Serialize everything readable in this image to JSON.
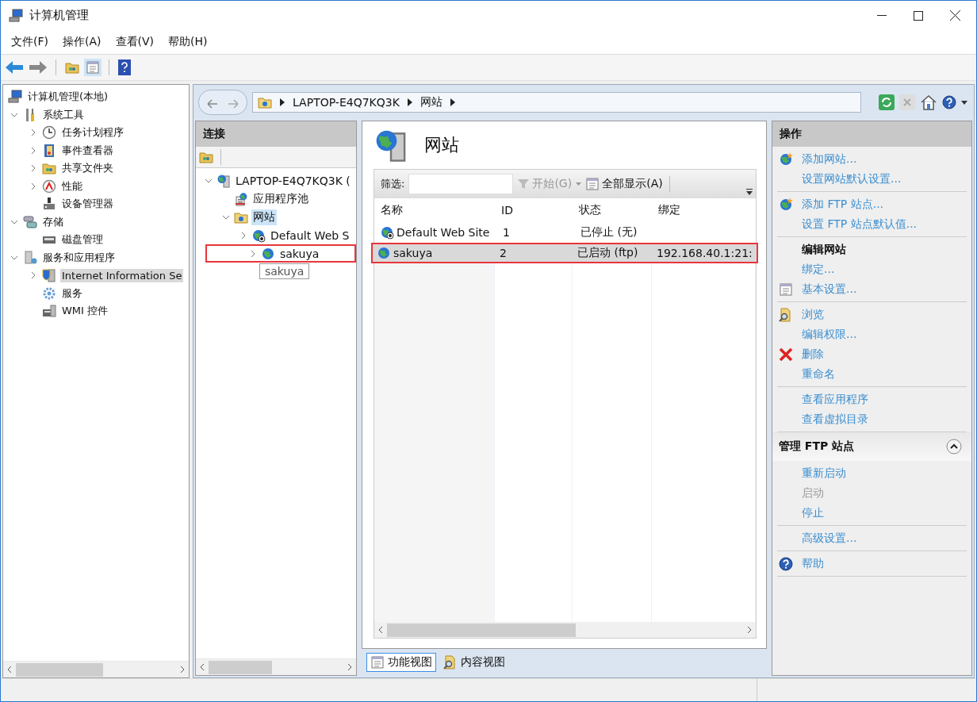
{
  "window": {
    "title": "计算机管理"
  },
  "menu": [
    "文件(F)",
    "操作(A)",
    "查看(V)",
    "帮助(H)"
  ],
  "console_tree": {
    "items": [
      {
        "label": "计算机管理(本地)",
        "selected": false,
        "children": [
          {
            "label": "系统工具",
            "expanded": true,
            "selected": false,
            "children": [
              {
                "label": "任务计划程序",
                "expanded": false,
                "selected": false
              },
              {
                "label": "事件查看器",
                "expanded": false,
                "selected": false
              },
              {
                "label": "共享文件夹",
                "expanded": false,
                "selected": false
              },
              {
                "label": "性能",
                "expanded": false,
                "selected": false
              },
              {
                "label": "设备管理器",
                "selected": false
              }
            ]
          },
          {
            "label": "存储",
            "expanded": true,
            "selected": false,
            "children": [
              {
                "label": "磁盘管理",
                "selected": false
              }
            ]
          },
          {
            "label": "服务和应用程序",
            "expanded": true,
            "selected": false,
            "children": [
              {
                "label": "Internet Information Se",
                "expanded": false,
                "selected": true
              },
              {
                "label": "服务",
                "selected": false
              },
              {
                "label": "WMI 控件",
                "selected": false
              }
            ]
          }
        ]
      }
    ]
  },
  "address_bar": {
    "crumbs": [
      "LAPTOP-E4Q7KQ3K",
      "网站"
    ]
  },
  "connections": {
    "title": "连接",
    "items": [
      {
        "label": "LAPTOP-E4Q7KQ3K (",
        "expanded": true,
        "selected": false,
        "annotated": false,
        "children": [
          {
            "label": "应用程序池",
            "selected": false,
            "annotated": false
          },
          {
            "label": "网站",
            "expanded": true,
            "selected": true,
            "annotated": false,
            "children": [
              {
                "label": "Default Web S",
                "expanded": false,
                "selected": false,
                "annotated": false
              },
              {
                "label": "sakuya",
                "expanded": false,
                "selected": false,
                "annotated": true
              }
            ]
          }
        ]
      }
    ],
    "tooltip": "sakuya"
  },
  "page": {
    "title": "网站",
    "filter": {
      "label": "筛选:",
      "start": "开始(G)",
      "start_disabled": true,
      "show_all": "全部显示(A)"
    },
    "table": {
      "columns": [
        "名称",
        "ID",
        "状态",
        "绑定"
      ],
      "rows": [
        {
          "cells": [
            "Default Web Site",
            "1",
            "已停止 (无)"
          ],
          "running": false,
          "selected": false,
          "annotated": false
        },
        {
          "cells": [
            "sakuya",
            "2",
            "已启动 (ftp)",
            "192.168.40.1:21:"
          ],
          "running": true,
          "selected": true,
          "annotated": true
        }
      ]
    },
    "view_tabs": [
      {
        "label": "功能视图",
        "selected": true
      },
      {
        "label": "内容视图",
        "selected": false
      }
    ]
  },
  "actions": {
    "title": "操作",
    "sections": [
      {
        "groups": [
          [
            {
              "label": "添加网站...",
              "kind": "link"
            },
            {
              "label": "设置网站默认设置...",
              "kind": "link"
            }
          ],
          [
            {
              "label": "添加 FTP 站点...",
              "kind": "link"
            },
            {
              "label": "设置 FTP 站点默认值...",
              "kind": "link"
            }
          ],
          [
            {
              "label": "编辑网站",
              "kind": "heading"
            },
            {
              "label": "绑定...",
              "kind": "link"
            },
            {
              "label": "基本设置...",
              "kind": "link"
            }
          ],
          [
            {
              "label": "浏览",
              "kind": "link"
            },
            {
              "label": "编辑权限...",
              "kind": "link"
            },
            {
              "label": "删除",
              "kind": "link"
            },
            {
              "label": "重命名",
              "kind": "link"
            }
          ],
          [
            {
              "label": "查看应用程序",
              "kind": "link"
            },
            {
              "label": "查看虚拟目录",
              "kind": "link"
            }
          ]
        ]
      },
      {
        "title": "管理 FTP 站点",
        "expanded": true,
        "groups": [
          [
            {
              "label": "重新启动",
              "kind": "link"
            },
            {
              "label": "启动",
              "kind": "disabled"
            },
            {
              "label": "停止",
              "kind": "link"
            }
          ],
          [
            {
              "label": "高级设置...",
              "kind": "link"
            }
          ],
          [
            {
              "label": "帮助",
              "kind": "link"
            }
          ]
        ]
      }
    ]
  }
}
